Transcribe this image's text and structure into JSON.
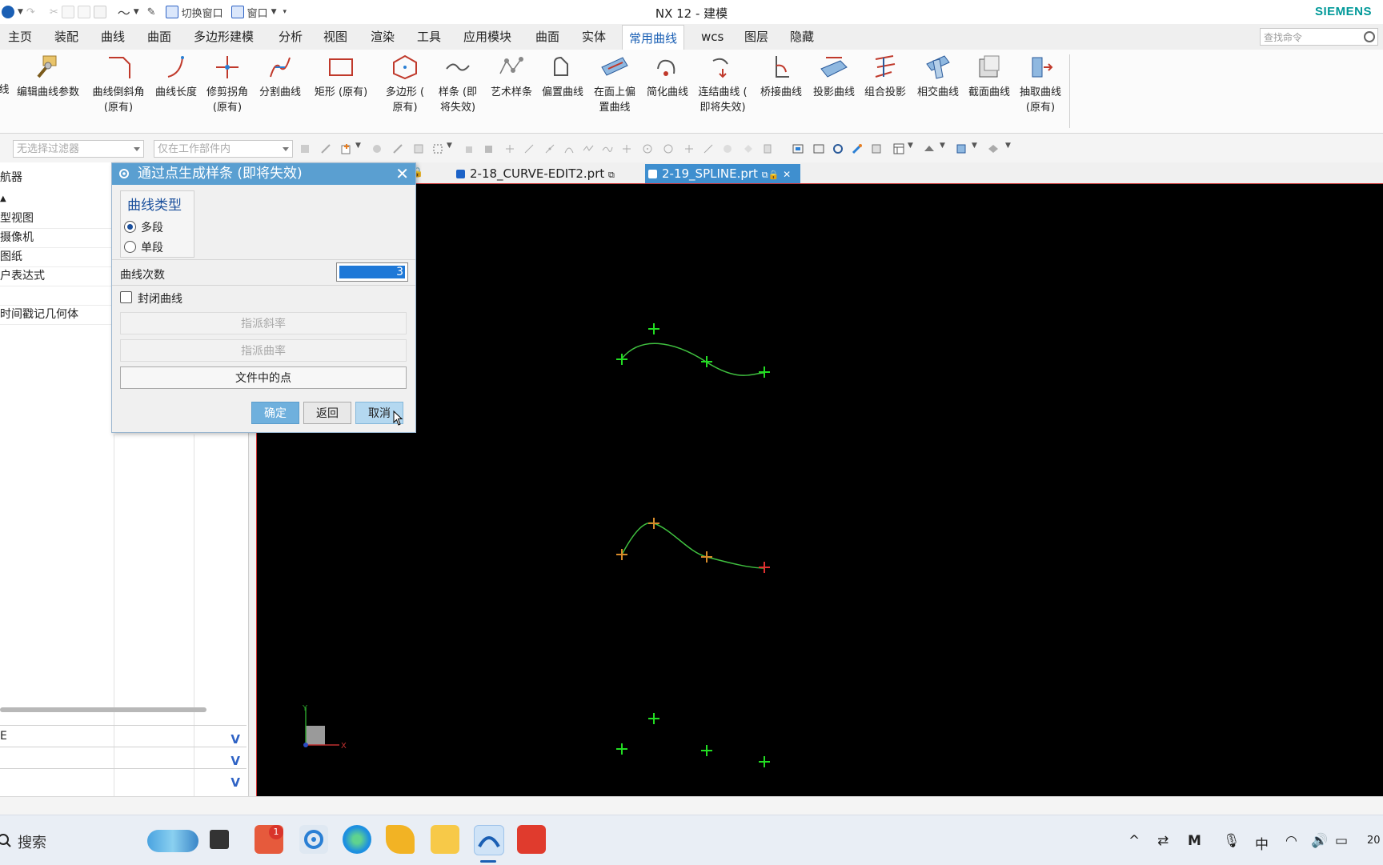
{
  "window": {
    "title": "NX 12 - 建模",
    "brand": "SIEMENS"
  },
  "quick_access": {
    "switch_window": "切换窗口",
    "window_menu": "窗口"
  },
  "menu": {
    "items": [
      "主页",
      "装配",
      "曲线",
      "曲面",
      "多边形建模",
      "分析",
      "视图",
      "渲染",
      "工具",
      "应用模块",
      "曲面",
      "实体",
      "常用曲线",
      "wcs",
      "图层",
      "隐藏"
    ],
    "active_index": 12,
    "search_placeholder": "查找命令"
  },
  "ribbon": {
    "partial_left": "线",
    "buttons": [
      {
        "line1": "编辑曲线参数",
        "line2": ""
      },
      {
        "line1": "曲线倒斜角",
        "line2": "(原有)"
      },
      {
        "line1": "曲线长度",
        "line2": ""
      },
      {
        "line1": "修剪拐角",
        "line2": "(原有)"
      },
      {
        "line1": "分割曲线",
        "line2": ""
      },
      {
        "line1": "矩形 (原有)",
        "line2": ""
      },
      {
        "line1": "多边形 (",
        "line2": "原有)"
      },
      {
        "line1": "样条 (即",
        "line2": "将失效)"
      },
      {
        "line1": "艺术样条",
        "line2": ""
      },
      {
        "line1": "偏置曲线",
        "line2": ""
      },
      {
        "line1": "在面上偏",
        "line2": "置曲线"
      },
      {
        "line1": "简化曲线",
        "line2": ""
      },
      {
        "line1": "连结曲线 (",
        "line2": "即将失效)"
      },
      {
        "line1": "桥接曲线",
        "line2": ""
      },
      {
        "line1": "投影曲线",
        "line2": ""
      },
      {
        "line1": "组合投影",
        "line2": ""
      },
      {
        "line1": "相交曲线",
        "line2": ""
      },
      {
        "line1": "截面曲线",
        "line2": ""
      },
      {
        "line1": "抽取曲线",
        "line2": "(原有)"
      }
    ]
  },
  "filters": {
    "type_filter": "无选择过滤器",
    "scope_filter": "仅在工作部件内"
  },
  "navigator": {
    "title": "航器",
    "rows": [
      "型视图",
      "摄像机",
      "图纸",
      "户表达式",
      "",
      "时间戳记几何体"
    ]
  },
  "tabs": [
    {
      "label": "2-18_CURVE-EDIT2.prt",
      "active": false
    },
    {
      "label": "2-19_SPLINE.prt",
      "active": true
    }
  ],
  "dialog": {
    "title": "通过点生成样条 (即将失效)",
    "curve_type_label": "曲线类型",
    "radio_multi": "多段",
    "radio_single": "单段",
    "selected_type": "多段",
    "degree_label": "曲线次数",
    "degree_value": "3",
    "closed_label": "封闭曲线",
    "closed_checked": false,
    "assign_slope": "指派斜率",
    "assign_curvature": "指派曲率",
    "points_from_file": "文件中的点",
    "ok": "确定",
    "back": "返回",
    "cancel": "取消"
  },
  "taskbar": {
    "search_placeholder": "搜索",
    "badge_count": "1",
    "ime": "中",
    "clock_partial": "20"
  },
  "colors": {
    "dialog_header": "#5a9fd1",
    "active_tab": "#3f8fcf",
    "spline_curve": "#3fbf3f",
    "point_marker": "#22dd22",
    "viewport_bg": "#000000",
    "brand": "#009999"
  }
}
